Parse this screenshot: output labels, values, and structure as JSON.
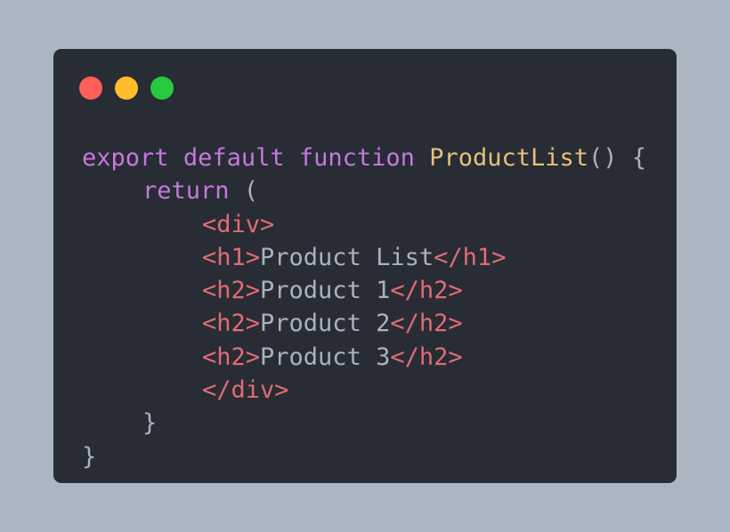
{
  "window": {
    "controls": {
      "close": {
        "color": "#ff5f56",
        "icon": "close-dot-icon"
      },
      "minimize": {
        "color": "#ffbd2e",
        "icon": "minimize-dot-icon"
      },
      "maximize": {
        "color": "#27c93f",
        "icon": "maximize-dot-icon"
      }
    }
  },
  "colors": {
    "background": "#abb6c2",
    "editor": "#282c34",
    "keyword": "#c678dd",
    "function_name": "#e5c07b",
    "tag": "#e06c75",
    "text": "#abb2bf"
  },
  "code": {
    "line1": {
      "kw_export": "export",
      "kw_default": "default",
      "kw_function": "function",
      "fn_name": "ProductList",
      "rest": "() {"
    },
    "line2": {
      "kw_return": "return",
      "rest": " ("
    },
    "line3": {
      "open_div": "<div>"
    },
    "line4": {
      "open_tag": "<h1>",
      "text": "Product List",
      "close_tag": "</h1>"
    },
    "line5": {
      "open_tag": "<h2>",
      "text": "Product 1",
      "close_tag": "</h2>"
    },
    "line6": {
      "open_tag": "<h2>",
      "text": "Product 2",
      "close_tag": "</h2>"
    },
    "line7": {
      "open_tag": "<h2>",
      "text": "Product 3",
      "close_tag": "</h2>"
    },
    "line8": {
      "close_div": "</div>"
    },
    "line9": {
      "brace": "}"
    },
    "line10": {
      "brace": "}"
    }
  }
}
